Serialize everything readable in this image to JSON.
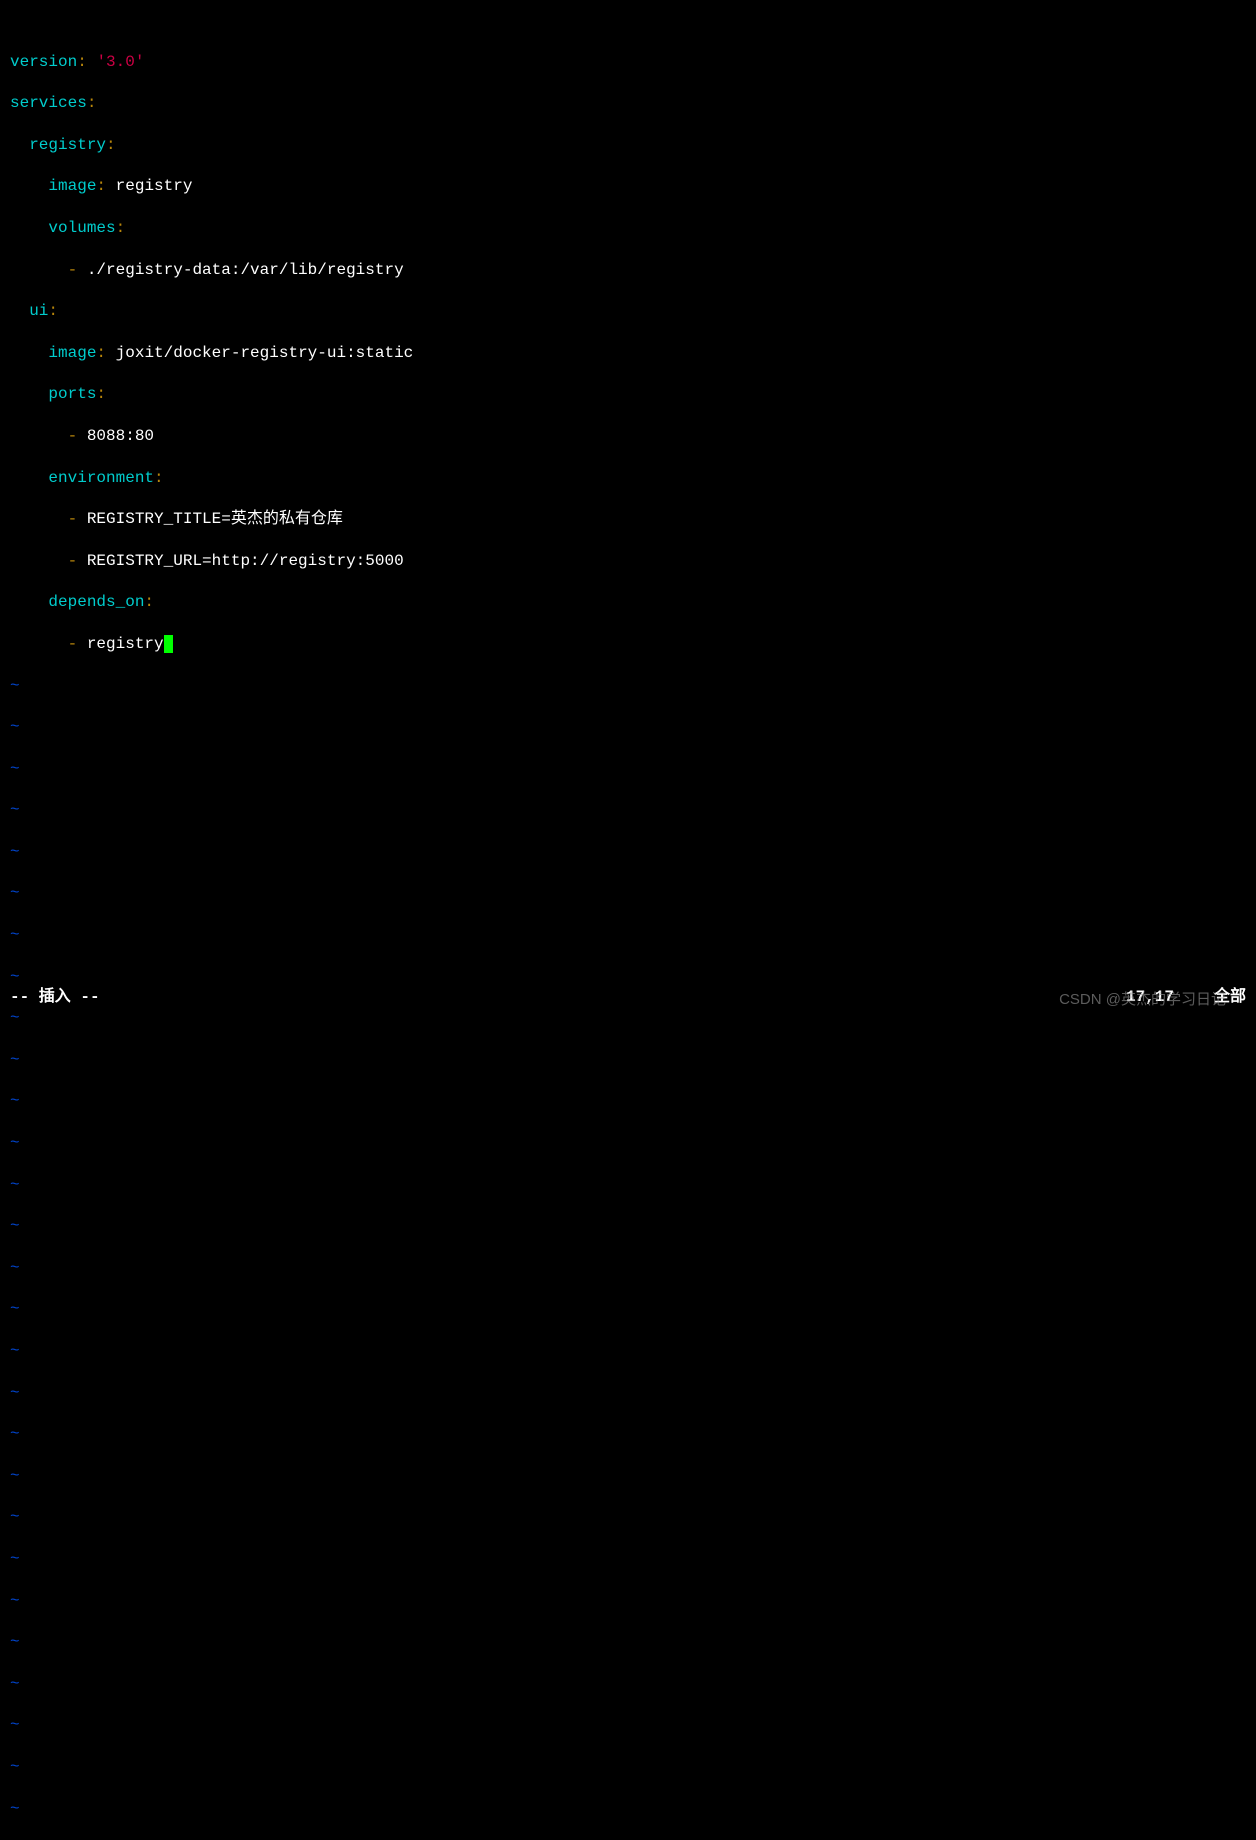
{
  "yaml": {
    "version_key": "version",
    "version_val": "'3.0'",
    "services_key": "services",
    "registry_key": "registry",
    "image_key": "image",
    "registry_image_val": " registry",
    "volumes_key": "volumes",
    "registry_volume": " ./registry-data:/var/lib/registry",
    "ui_key": "ui",
    "ui_image_val": " joxit/docker-registry-ui:static",
    "ports_key": "ports",
    "ui_port": " 8088:80",
    "environment_key": "environment",
    "env_title": " REGISTRY_TITLE=英杰的私有仓库",
    "env_url": " REGISTRY_URL=http://registry:5000",
    "depends_on_key": "depends_on",
    "depends_val": " registry"
  },
  "tilde": "~",
  "status": {
    "mode": "-- 插入 --",
    "position": "17,17",
    "scroll": "全部"
  },
  "watermark": "CSDN @英杰的学习日记"
}
